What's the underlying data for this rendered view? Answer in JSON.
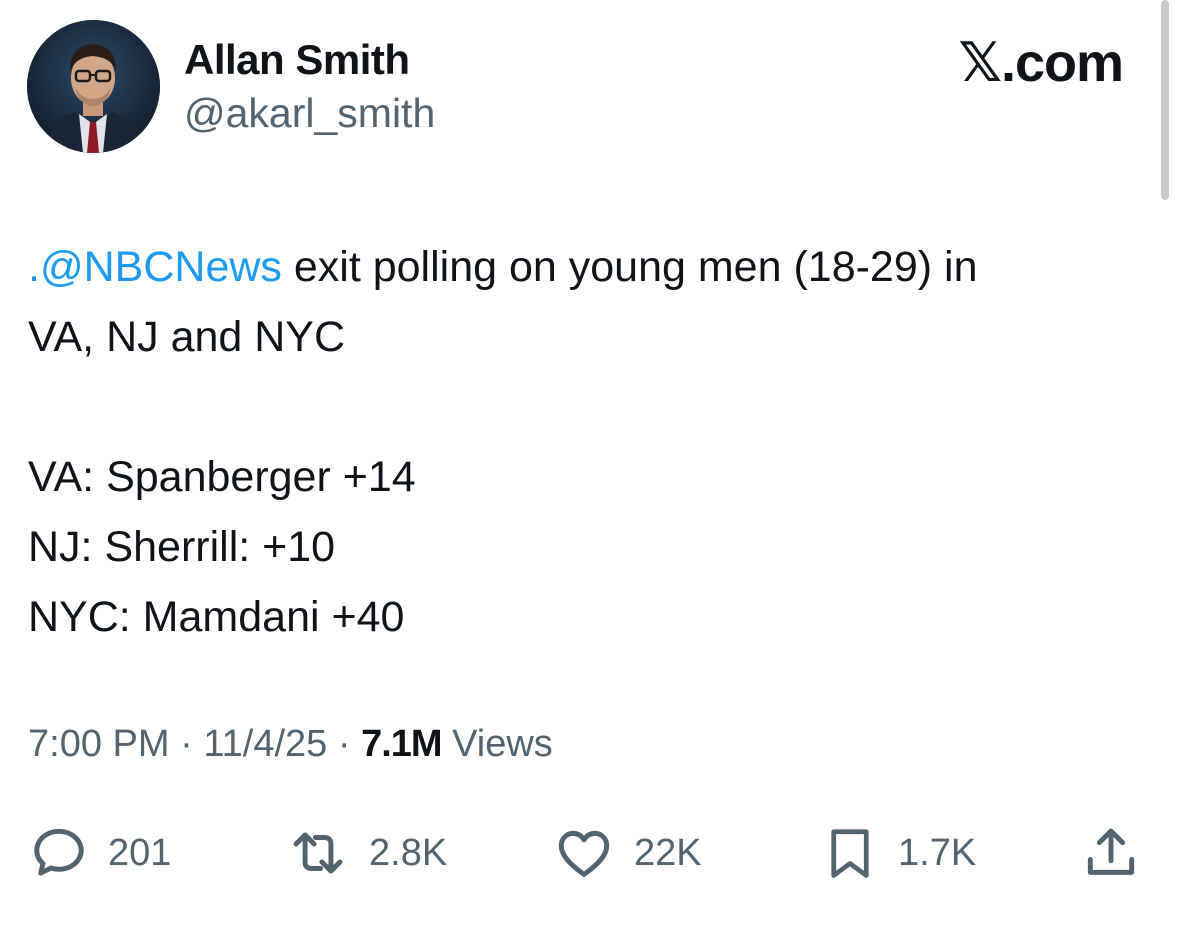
{
  "author": {
    "display_name": "Allan Smith",
    "handle": "@akarl_smith"
  },
  "brand": {
    "x_letter": "𝕏",
    "domain": ".com"
  },
  "tweet": {
    "mention": ".@NBCNews",
    "line1_rest": " exit polling on young men (18-29) in",
    "line2": "VA, NJ and NYC",
    "result_va": "VA: Spanberger +14",
    "result_nj": "NJ: Sherrill: +10",
    "result_nyc": "NYC: Mamdani +40"
  },
  "meta": {
    "time": "7:00 PM",
    "date": "11/4/25",
    "views_count": "7.1M",
    "views_label": "Views",
    "separator": " · "
  },
  "actions": {
    "replies": {
      "icon": "reply-icon",
      "count": "201"
    },
    "reposts": {
      "icon": "repost-icon",
      "count": "2.8K"
    },
    "likes": {
      "icon": "like-icon",
      "count": "22K"
    },
    "bookmarks": {
      "icon": "bookmark-icon",
      "count": "1.7K"
    },
    "share": {
      "icon": "share-icon"
    }
  },
  "colors": {
    "mention": "#1d9bf0",
    "text": "#0f1419",
    "secondary": "#536471"
  }
}
